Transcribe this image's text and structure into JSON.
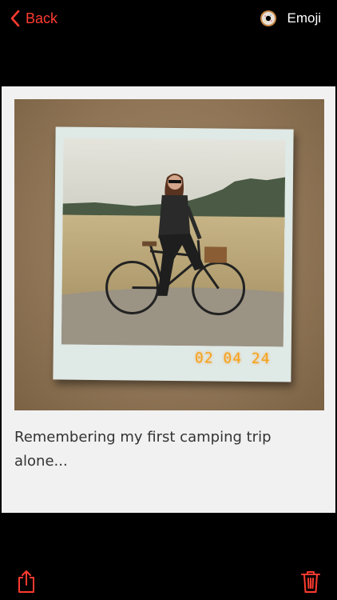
{
  "nav": {
    "back_label": "Back",
    "emoji_label": "Emoji",
    "accent_color": "#ff3b30"
  },
  "post": {
    "date_stamp": "02 04 24",
    "caption": "Remembering my first camping trip alone..."
  },
  "toolbar": {
    "share_icon": "share-icon",
    "trash_icon": "trash-icon"
  }
}
